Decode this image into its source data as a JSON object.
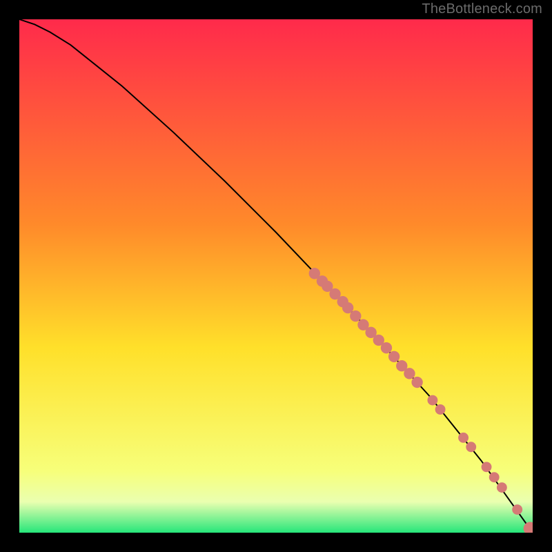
{
  "attribution": "TheBottleneck.com",
  "colors": {
    "gradient_top": "#ff2a4b",
    "gradient_mid1": "#ff8a2a",
    "gradient_mid2": "#ffe02a",
    "gradient_mid3": "#f7ff7a",
    "gradient_bottom": "#26e67a",
    "curve": "#000000",
    "marker": "#d57a76",
    "background": "#000000"
  },
  "chart_data": {
    "type": "line",
    "title": "",
    "xlabel": "",
    "ylabel": "",
    "xlim": [
      0,
      100
    ],
    "ylim": [
      0,
      100
    ],
    "curve": {
      "name": "bottleneck-curve",
      "x": [
        0,
        3,
        6,
        10,
        15,
        20,
        30,
        40,
        50,
        60,
        70,
        80,
        90,
        100
      ],
      "y": [
        100,
        99,
        97.5,
        95,
        91,
        87,
        78,
        68.5,
        58.5,
        48,
        37.5,
        26.5,
        14,
        0
      ]
    },
    "markers": {
      "name": "highlighted-segment",
      "points": [
        {
          "x": 57.5,
          "y": 50.5,
          "r": 1.1
        },
        {
          "x": 59.0,
          "y": 49.0,
          "r": 1.1
        },
        {
          "x": 60.0,
          "y": 48.0,
          "r": 1.1
        },
        {
          "x": 61.5,
          "y": 46.5,
          "r": 1.1
        },
        {
          "x": 63.0,
          "y": 45.0,
          "r": 1.1
        },
        {
          "x": 64.0,
          "y": 43.8,
          "r": 1.1
        },
        {
          "x": 65.5,
          "y": 42.2,
          "r": 1.1
        },
        {
          "x": 67.0,
          "y": 40.5,
          "r": 1.1
        },
        {
          "x": 68.5,
          "y": 39.0,
          "r": 1.1
        },
        {
          "x": 70.0,
          "y": 37.5,
          "r": 1.1
        },
        {
          "x": 71.5,
          "y": 36.0,
          "r": 1.1
        },
        {
          "x": 73.0,
          "y": 34.3,
          "r": 1.1
        },
        {
          "x": 74.5,
          "y": 32.5,
          "r": 1.1
        },
        {
          "x": 76.0,
          "y": 31.0,
          "r": 1.1
        },
        {
          "x": 77.5,
          "y": 29.3,
          "r": 1.1
        },
        {
          "x": 80.5,
          "y": 25.8,
          "r": 1.0
        },
        {
          "x": 82.0,
          "y": 24.0,
          "r": 1.0
        },
        {
          "x": 86.5,
          "y": 18.5,
          "r": 1.0
        },
        {
          "x": 88.0,
          "y": 16.7,
          "r": 1.0
        },
        {
          "x": 91.0,
          "y": 12.8,
          "r": 1.0
        },
        {
          "x": 92.5,
          "y": 10.8,
          "r": 1.0
        },
        {
          "x": 94.0,
          "y": 8.8,
          "r": 1.0
        },
        {
          "x": 97.0,
          "y": 4.5,
          "r": 1.0
        },
        {
          "x": 99.5,
          "y": 0.8,
          "r": 1.3
        },
        {
          "x": 101.0,
          "y": 0.3,
          "r": 1.3
        }
      ]
    }
  }
}
